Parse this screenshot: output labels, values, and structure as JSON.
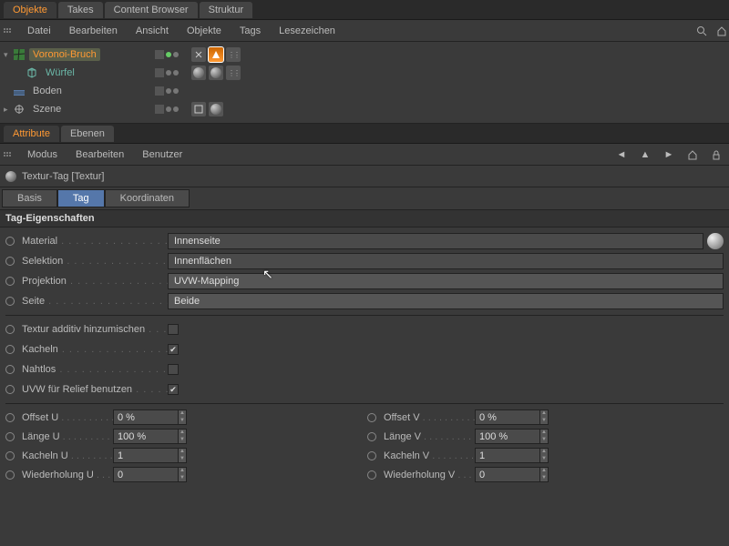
{
  "panel1": {
    "tabs": [
      "Objekte",
      "Takes",
      "Content Browser",
      "Struktur"
    ],
    "menu": [
      "Datei",
      "Bearbeiten",
      "Ansicht",
      "Objekte",
      "Tags",
      "Lesezeichen"
    ],
    "tree": {
      "voronoi": "Voronoi-Bruch",
      "wuerfel": "Würfel",
      "boden": "Boden",
      "szene": "Szene"
    }
  },
  "panel2": {
    "tabs": [
      "Attribute",
      "Ebenen"
    ],
    "menu": [
      "Modus",
      "Bearbeiten",
      "Benutzer"
    ],
    "title": "Textur-Tag [Textur]",
    "subtabs": {
      "basis": "Basis",
      "tag": "Tag",
      "koord": "Koordinaten"
    },
    "section": "Tag-Eigenschaften",
    "props": {
      "material_l": "Material",
      "material_v": "Innenseite",
      "selektion_l": "Selektion",
      "selektion_v": "Innenflächen",
      "projektion_l": "Projektion",
      "projektion_v": "UVW-Mapping",
      "seite_l": "Seite",
      "seite_v": "Beide",
      "additiv_l": "Textur additiv hinzumischen",
      "kacheln_l": "Kacheln",
      "nahtlos_l": "Nahtlos",
      "uvwrelief_l": "UVW für Relief benutzen",
      "offsetu_l": "Offset U",
      "offsetu_v": "0 %",
      "offsetv_l": "Offset V",
      "offsetv_v": "0 %",
      "laengeu_l": "Länge U",
      "laengeu_v": "100 %",
      "laengev_l": "Länge V",
      "laengev_v": "100 %",
      "kachelnu_l": "Kacheln U",
      "kachelnu_v": "1",
      "kachelnv_l": "Kacheln V",
      "kachelnv_v": "1",
      "wiedu_l": "Wiederholung U",
      "wiedu_v": "0",
      "wiedv_l": "Wiederholung V",
      "wiedv_v": "0"
    }
  }
}
